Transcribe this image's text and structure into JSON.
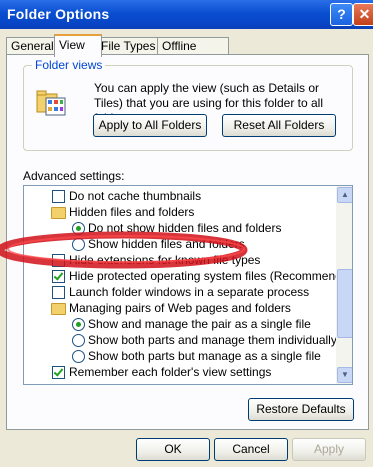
{
  "window": {
    "title": "Folder Options",
    "help_glyph": "?",
    "close_glyph": "✕"
  },
  "tabs": [
    {
      "label": "General"
    },
    {
      "label": "View"
    },
    {
      "label": "File Types"
    },
    {
      "label": "Offline Files"
    }
  ],
  "folder_views": {
    "label": "Folder views",
    "description": "You can apply the view (such as Details or Tiles) that you are using for this folder to all folders.",
    "apply_button": "Apply to All Folders",
    "reset_button": "Reset All Folders"
  },
  "advanced": {
    "label": "Advanced settings:",
    "items": [
      {
        "type": "checkbox",
        "checked": false,
        "label": "Do not cache thumbnails"
      },
      {
        "type": "folder",
        "label": "Hidden files and folders"
      },
      {
        "type": "radio",
        "checked": true,
        "label": "Do not show hidden files and folders"
      },
      {
        "type": "radio",
        "checked": false,
        "label": "Show hidden files and folders"
      },
      {
        "type": "checkbox",
        "checked": false,
        "label": "Hide extensions for known file types"
      },
      {
        "type": "checkbox",
        "checked": true,
        "label": "Hide protected operating system files (Recommended)"
      },
      {
        "type": "checkbox",
        "checked": false,
        "label": "Launch folder windows in a separate process"
      },
      {
        "type": "folder",
        "label": "Managing pairs of Web pages and folders"
      },
      {
        "type": "radio",
        "checked": true,
        "label": "Show and manage the pair as a single file"
      },
      {
        "type": "radio",
        "checked": false,
        "label": "Show both parts and manage them individually"
      },
      {
        "type": "radio",
        "checked": false,
        "label": "Show both parts but manage as a single file"
      },
      {
        "type": "checkbox",
        "checked": true,
        "label": "Remember each folder's view settings"
      }
    ],
    "restore_button": "Restore Defaults"
  },
  "footer": {
    "ok": "OK",
    "cancel": "Cancel",
    "apply": "Apply"
  },
  "colors": {
    "titlebar": "#0a4fd0",
    "group_label": "#0046d5",
    "highlight_oval": "#d0101a"
  }
}
